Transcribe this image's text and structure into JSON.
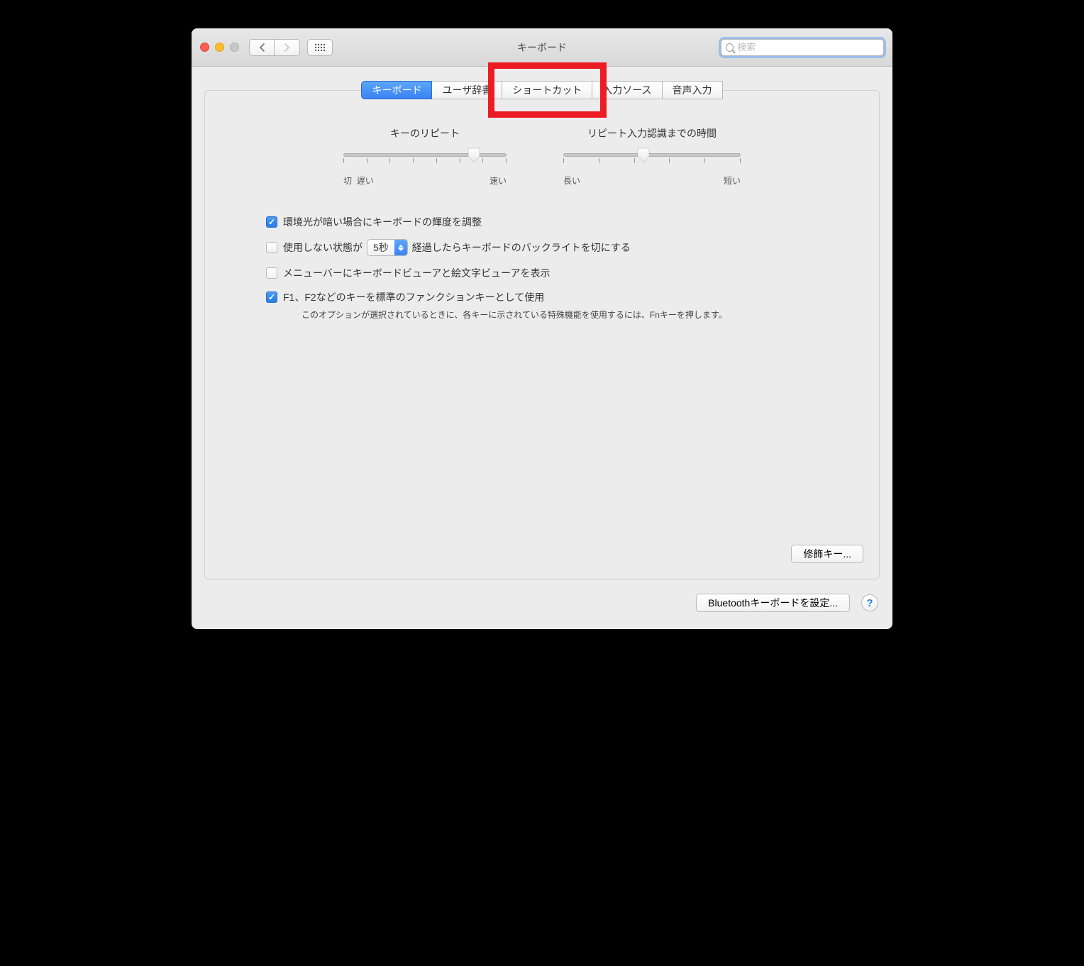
{
  "window": {
    "title": "キーボード",
    "search_placeholder": "検索"
  },
  "tabs": {
    "items": [
      {
        "label": "キーボード",
        "active": true
      },
      {
        "label": "ユーザ辞書",
        "active": false
      },
      {
        "label": "ショートカット",
        "active": false,
        "highlighted": true
      },
      {
        "label": "入力ソース",
        "active": false
      },
      {
        "label": "音声入力",
        "active": false
      }
    ]
  },
  "sliders": {
    "key_repeat": {
      "label": "キーのリピート",
      "left_label": "切",
      "left_label2": "遅い",
      "right_label": "速い",
      "value_pct": 80,
      "ticks": 8
    },
    "delay": {
      "label": "リピート入力認識までの時間",
      "left_label": "長い",
      "right_label": "短い",
      "value_pct": 45,
      "ticks": 6
    }
  },
  "checkboxes": {
    "ambient": {
      "checked": true,
      "label": "環境光が暗い場合にキーボードの輝度を調整"
    },
    "backlight_off": {
      "checked": false,
      "label_before": "使用しない状態が",
      "select_value": "5秒",
      "label_after": "経過したらキーボードのバックライトを切にする"
    },
    "menubar_viewers": {
      "checked": false,
      "label": "メニューバーにキーボードビューアと絵文字ビューアを表示"
    },
    "fn_keys": {
      "checked": true,
      "label": "F1、F2などのキーを標準のファンクションキーとして使用",
      "helper": "このオプションが選択されているときに、各キーに示されている特殊機能を使用するには、Fnキーを押します。"
    }
  },
  "buttons": {
    "modifier_keys": "修飾キー...",
    "bluetooth_setup": "Bluetoothキーボードを設定...",
    "help": "?"
  }
}
